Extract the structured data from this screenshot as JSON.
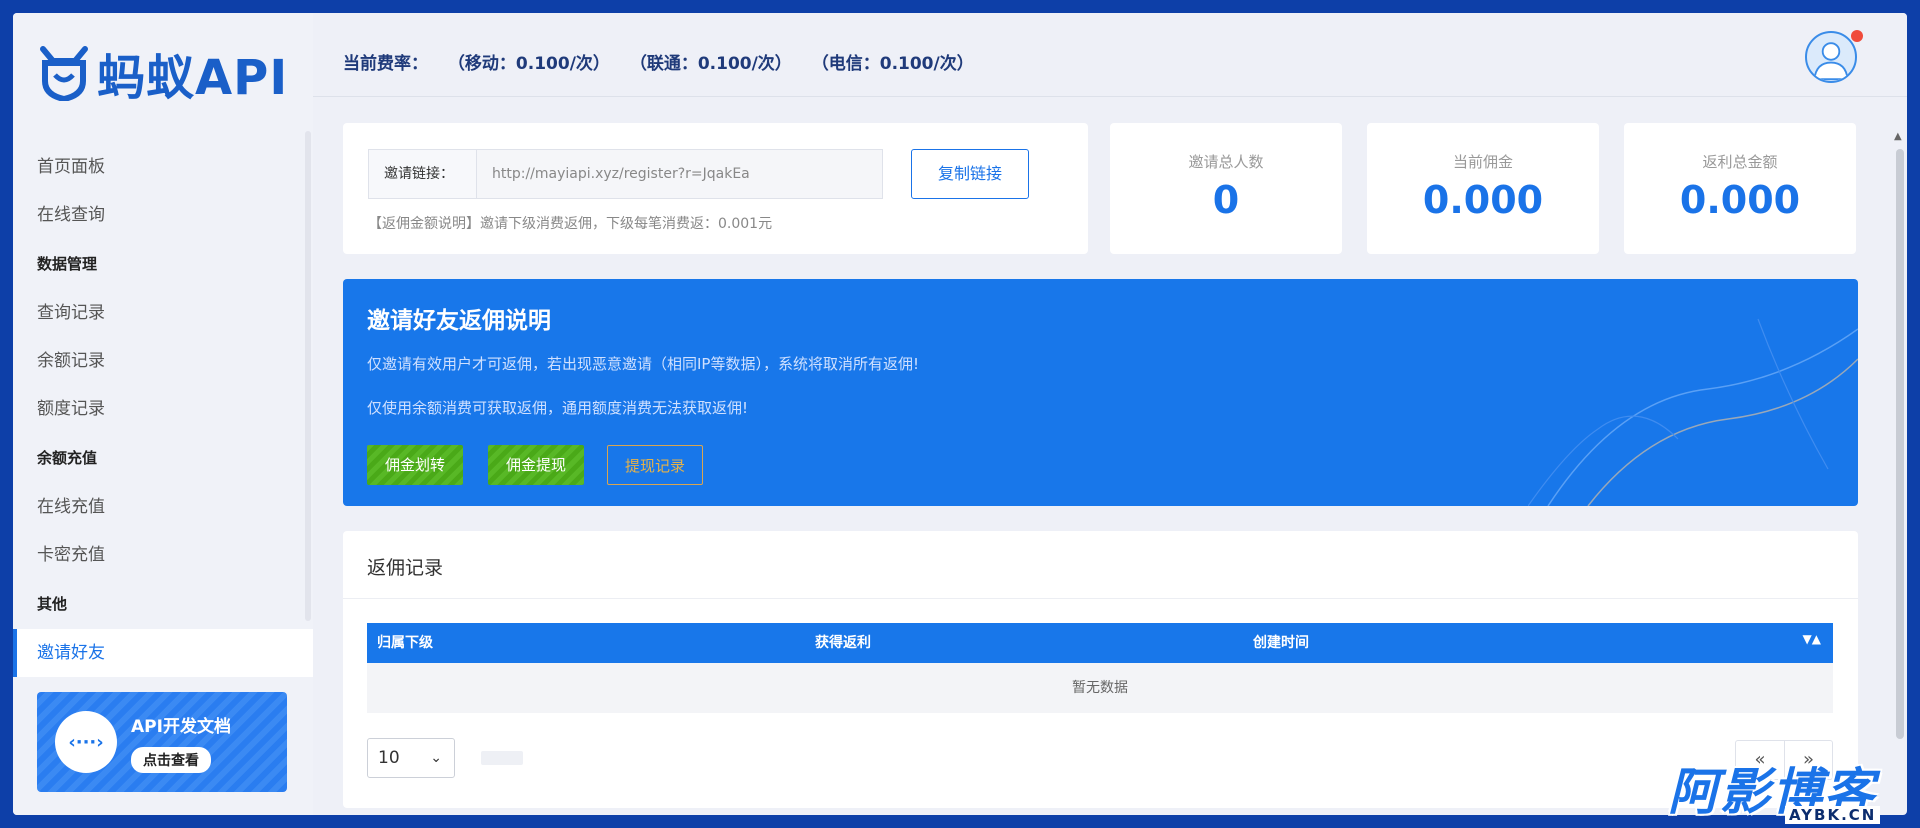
{
  "brand": {
    "name": "蚂蚁API"
  },
  "sidebar": {
    "items": [
      {
        "type": "item",
        "label": "首页面板"
      },
      {
        "type": "item",
        "label": "在线查询"
      },
      {
        "type": "group",
        "label": "数据管理"
      },
      {
        "type": "item",
        "label": "查询记录"
      },
      {
        "type": "item",
        "label": "余额记录"
      },
      {
        "type": "item",
        "label": "额度记录"
      },
      {
        "type": "group",
        "label": "余额充值"
      },
      {
        "type": "item",
        "label": "在线充值"
      },
      {
        "type": "item",
        "label": "卡密充值"
      },
      {
        "type": "group",
        "label": "其他"
      },
      {
        "type": "item",
        "label": "邀请好友",
        "active": true
      }
    ],
    "doc_card": {
      "title": "API开发文档",
      "button": "点击查看",
      "icon": "code-icon"
    }
  },
  "header": {
    "rate_label": "当前费率：",
    "rates": [
      "（移动：0.100/次）",
      "（联通：0.100/次）",
      "（电信：0.100/次）"
    ],
    "avatar_icon": "user-avatar-icon"
  },
  "invite": {
    "label": "邀请链接：",
    "link": "http://mayiapi.xyz/register?r=JqakEa",
    "copy_button": "复制链接",
    "note": "【返佣金额说明】邀请下级消费返佣，下级每笔消费返：0.001元"
  },
  "stats": [
    {
      "label": "邀请总人数",
      "value": "0"
    },
    {
      "label": "当前佣金",
      "value": "0.000"
    },
    {
      "label": "返利总金额",
      "value": "0.000"
    }
  ],
  "banner": {
    "title": "邀请好友返佣说明",
    "line1": "仅邀请有效用户才可返佣，若出现恶意邀请（相同IP等数据），系统将取消所有返佣!",
    "line2": "仅使用余额消费可获取返佣，通用额度消费无法获取返佣!",
    "buttons": [
      "佣金划转",
      "佣金提现",
      "提现记录"
    ]
  },
  "records": {
    "title": "返佣记录",
    "columns": [
      "归属下级",
      "获得返利",
      "创建时间"
    ],
    "empty_text": "暂无数据",
    "page_size": "10",
    "pager": [
      "«",
      "»"
    ]
  },
  "watermark": {
    "main": "阿影博客",
    "sub": "AYBK.CN"
  },
  "colors": {
    "accent": "#1a73e8",
    "banner": "#1877ea",
    "green": "#4cad1a",
    "frame": "#0d3fa8"
  }
}
